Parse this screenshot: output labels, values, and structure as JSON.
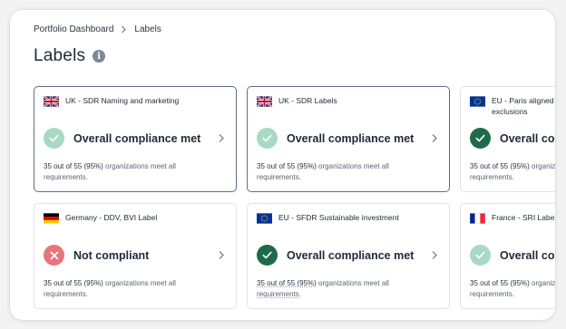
{
  "breadcrumb": {
    "root": "Portfolio Dashboard",
    "current": "Labels"
  },
  "page": {
    "title": "Labels",
    "info_glyph": "i"
  },
  "colors": {
    "met_light": "#a7d9c4",
    "met_dark": "#1d6b4b",
    "not_compliant": "#e8737c",
    "selected_border": "#5e6e86"
  },
  "cards": [
    {
      "name": "UK - SDR Naming and marketing",
      "flag": "uk-flag-icon",
      "status": "Overall compliance met",
      "status_kind": "met-light",
      "summary_lead": "35 out of 55 (95%)",
      "summary_rest": " organizations meet all",
      "summary_tail": "requirements.",
      "selected": true
    },
    {
      "name": "UK - SDR Labels",
      "flag": "uk-flag-icon",
      "status": "Overall compliance met",
      "status_kind": "met-light",
      "summary_lead": "35 out of 55 (95%)",
      "summary_rest": " organizations meet all",
      "summary_tail": "requirements.",
      "selected": true
    },
    {
      "name": "EU - Paris aligned exclusions",
      "flag": "eu-flag-icon",
      "status": "Overall compliance met",
      "status_kind": "met-dark",
      "summary_lead": "35 out of 55 (95%)",
      "summary_rest": " organizations meet all",
      "summary_tail": "requirements.",
      "selected": false
    },
    {
      "name": "Germany - DDV, BVI Label",
      "flag": "germany-flag-icon",
      "status": "Not compliant",
      "status_kind": "not",
      "summary_lead": "35 out of 55 (95%)",
      "summary_rest": " organizations meet all",
      "summary_tail": "requirements.",
      "selected": false
    },
    {
      "name": "EU - SFDR Sustainable investment",
      "flag": "eu-flag-icon",
      "status": "Overall compliance met",
      "status_kind": "met-dark",
      "summary_lead": "35 out of 55 (95%)",
      "summary_rest": " organizations meet all",
      "summary_tail": "requirements.",
      "selected": false
    },
    {
      "name": "France - SRI Label",
      "flag": "france-flag-icon",
      "status": "Overall compliance met",
      "status_kind": "met-light",
      "summary_lead": "35 out of 55 (95%)",
      "summary_rest": " organizations meet all",
      "summary_tail": "requirements.",
      "selected": false
    }
  ]
}
